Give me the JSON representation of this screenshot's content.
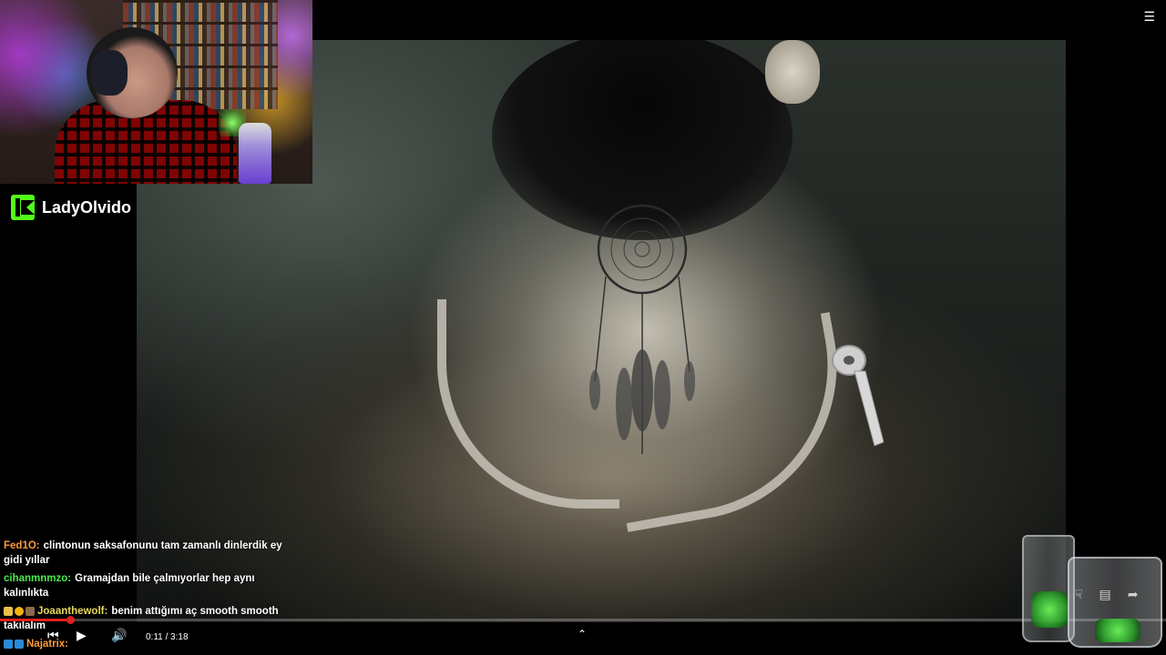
{
  "stream": {
    "channel_name": "LadyOlvido"
  },
  "chat": {
    "messages": [
      {
        "user": "Fed1O:",
        "text": "clintonun saksafonunu tam zamanlı dinlerdik ey gidi yıllar",
        "user_color": "#ff9b3a"
      },
      {
        "user": "cihanmnmzo:",
        "text": "Gramajdan bile çalmıyorlar hep aynı kalınlıkta",
        "user_color": "#4be84b"
      },
      {
        "user": "Joaanthewolf:",
        "text": "benim attığımı aç smooth smooth takılalım",
        "user_color": "#e8d85b"
      },
      {
        "user": "Najatrix:",
        "text": "",
        "user_color": "#ff9b3a"
      }
    ]
  },
  "player": {
    "time": "0:11 / 3:18",
    "progress": 0.06
  },
  "colors": {
    "kick_green": "#53fc18",
    "progress_red": "#e02020"
  },
  "icons": {
    "prev": "skip-previous-icon",
    "play": "play-icon",
    "volume": "volume-icon",
    "expand": "chevron-up-icon",
    "menu": "playlist-icon",
    "dislike": "thumbs-down-icon",
    "comment": "comment-icon",
    "share": "share-icon"
  }
}
